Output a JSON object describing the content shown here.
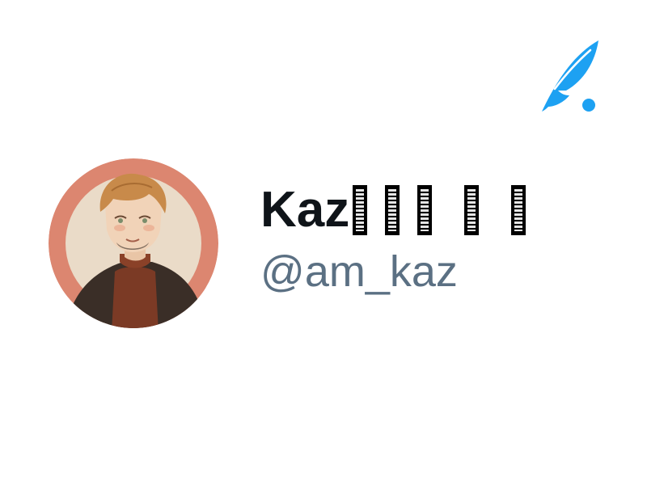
{
  "app": {
    "logo_icon": "feather-quill-icon",
    "accent_color": "#1da1f2"
  },
  "profile": {
    "display_name": "Kaz",
    "name_missing_glyphs": 5,
    "handle": "@am_kaz",
    "avatar_icon": "illustrated-avatar-icon",
    "avatar_ring_color": "#dc8670"
  },
  "colors": {
    "name_text": "#0f1419",
    "handle_text": "#5b7083"
  }
}
